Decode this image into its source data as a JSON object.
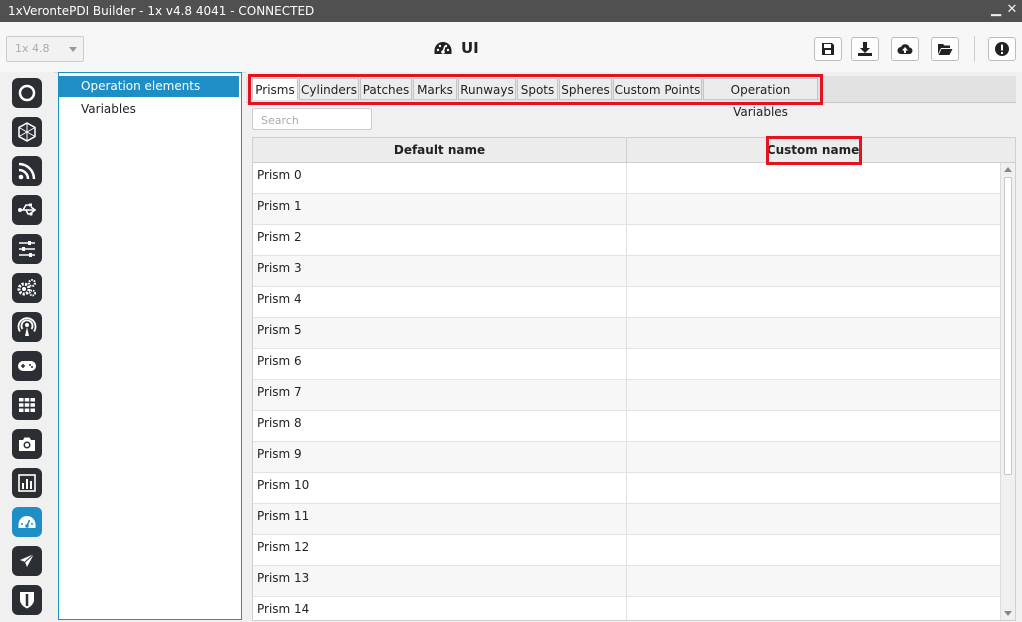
{
  "window": {
    "title": "1xVerontePDI Builder - 1x v4.8 4041 - CONNECTED"
  },
  "toolbar": {
    "version_value": "1x 4.8",
    "page_title": "UI",
    "page_icon": "gauge-icon",
    "buttons": [
      "save-icon",
      "download-icon",
      "cloud-upload-icon",
      "folder-open-icon",
      "alert-icon"
    ]
  },
  "sidebar": {
    "icons": [
      "circle-ring-icon",
      "network-icon",
      "rss-feed-icon",
      "usb-icon",
      "sliders-icon",
      "gears-icon",
      "broadcast-icon",
      "gamepad-icon",
      "grid-icon",
      "camera-icon",
      "bar-chart-icon",
      "gauge-icon",
      "airplane-icon",
      "shield-icon"
    ],
    "active": "gauge-icon"
  },
  "nav": {
    "items": [
      {
        "label": "Operation elements",
        "selected": true
      },
      {
        "label": "Variables",
        "selected": false
      }
    ]
  },
  "tabs": [
    {
      "label": "Prisms",
      "active": true
    },
    {
      "label": "Cylinders"
    },
    {
      "label": "Patches"
    },
    {
      "label": "Marks"
    },
    {
      "label": "Runways"
    },
    {
      "label": "Spots"
    },
    {
      "label": "Spheres"
    },
    {
      "label": "Custom Points"
    },
    {
      "label": "Operation Variables"
    }
  ],
  "search": {
    "placeholder": "Search",
    "value": ""
  },
  "table": {
    "columns": [
      "Default name",
      "Custom name"
    ],
    "rows": [
      [
        "Prism 0",
        ""
      ],
      [
        "Prism 1",
        ""
      ],
      [
        "Prism 2",
        ""
      ],
      [
        "Prism 3",
        ""
      ],
      [
        "Prism 4",
        ""
      ],
      [
        "Prism 5",
        ""
      ],
      [
        "Prism 6",
        ""
      ],
      [
        "Prism 7",
        ""
      ],
      [
        "Prism 8",
        ""
      ],
      [
        "Prism 9",
        ""
      ],
      [
        "Prism 10",
        ""
      ],
      [
        "Prism 11",
        ""
      ],
      [
        "Prism 12",
        ""
      ],
      [
        "Prism 13",
        ""
      ],
      [
        "Prism 14",
        ""
      ]
    ]
  },
  "colors": {
    "accent": "#1e8fc6",
    "highlight": "#e4121c",
    "dark_icon_bg": "#2b2e33",
    "titlebar": "#505050"
  }
}
